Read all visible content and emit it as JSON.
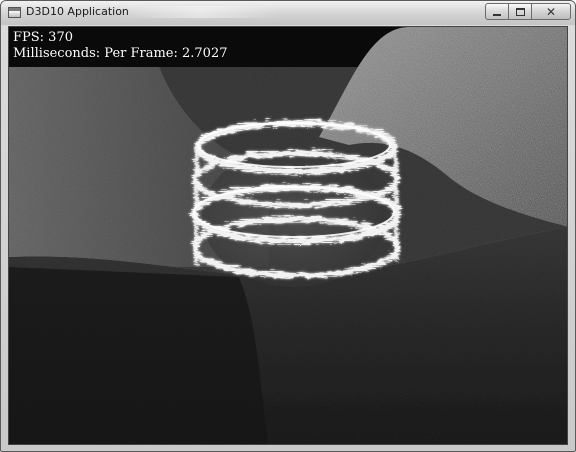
{
  "window": {
    "title": "D3D10 Application",
    "controls": {
      "minimize": "minimize",
      "maximize": "maximize",
      "close": "close"
    }
  },
  "hud": {
    "fps_text": "FPS: 370",
    "ms_text": "Milliseconds: Per Frame: 2.7027"
  },
  "icons": {
    "app": "application-icon",
    "minimize": "minimize-icon",
    "maximize": "maximize-icon",
    "close": "close-icon"
  }
}
